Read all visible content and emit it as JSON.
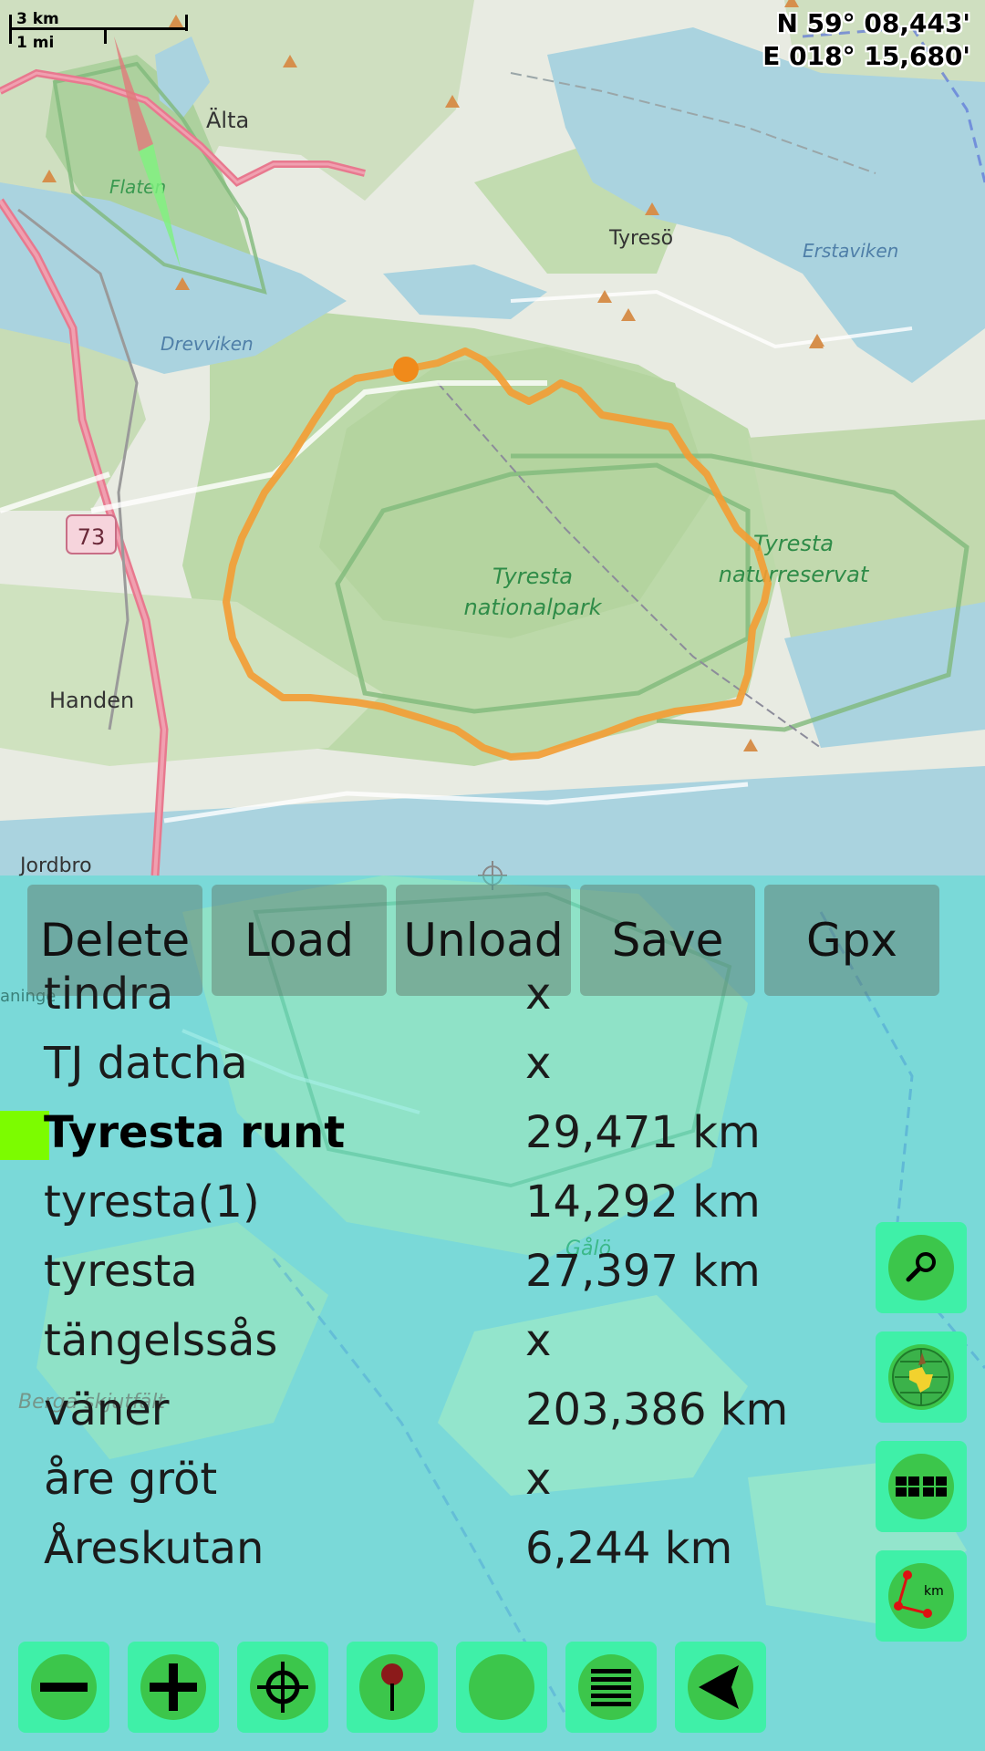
{
  "coordinates": {
    "lat": "N 59° 08,443'",
    "lon": "E 018° 15,680'"
  },
  "scale": {
    "km_label": "3 km",
    "mi_label": "1 mi"
  },
  "map_labels": {
    "alta": "Älta",
    "flaten": "Flaten",
    "tyreso": "Tyresö",
    "erstaviken": "Erstaviken",
    "drevviken": "Drevviken",
    "road_73": "73",
    "tyresta_np_1": "Tyresta",
    "tyresta_np_2": "nationalpark",
    "tyresta_nr_1": "Tyresta",
    "tyresta_nr_2": "naturreservat",
    "handen": "Handen",
    "jordbro": "Jordbro",
    "galo": "Gålö",
    "berga": "Berga skjutfält",
    "aninge": "aninge"
  },
  "toolbar": {
    "buttons": [
      "Delete",
      "Load",
      "Unload",
      "Save",
      "Gpx"
    ]
  },
  "tracks": [
    {
      "name": "tindra",
      "distance": "x",
      "selected": false
    },
    {
      "name": "TJ datcha",
      "distance": "x",
      "selected": false
    },
    {
      "name": "Tyresta runt",
      "distance": "29,471 km",
      "selected": true
    },
    {
      "name": "tyresta(1)",
      "distance": "14,292 km",
      "selected": false
    },
    {
      "name": "tyresta",
      "distance": "27,397 km",
      "selected": false
    },
    {
      "name": "tängelssås",
      "distance": "x",
      "selected": false
    },
    {
      "name": "väner",
      "distance": "203,386 km",
      "selected": false
    },
    {
      "name": "åre gröt",
      "distance": "x",
      "selected": false
    },
    {
      "name": "Åreskutan",
      "distance": "6,244 km",
      "selected": false
    }
  ],
  "side_buttons": [
    {
      "icon": "search-icon"
    },
    {
      "icon": "globe-icon"
    },
    {
      "icon": "map-tiles-icon"
    },
    {
      "icon": "measure-distance-icon",
      "label": "km"
    }
  ],
  "bottom_buttons": [
    {
      "icon": "zoom-out-icon"
    },
    {
      "icon": "zoom-in-icon"
    },
    {
      "icon": "locate-icon"
    },
    {
      "icon": "pin-icon"
    },
    {
      "icon": "record-icon"
    },
    {
      "icon": "list-icon"
    },
    {
      "icon": "navigate-icon"
    }
  ],
  "colors": {
    "track": "#f39c33",
    "selected_marker": "#7cfc00",
    "button_bg": "#3ff0a8",
    "button_disk": "#3cc64b",
    "panel_overlay": "rgba(64,224,208,0.45)",
    "water": "#aad3df",
    "forest": "#add19e"
  }
}
